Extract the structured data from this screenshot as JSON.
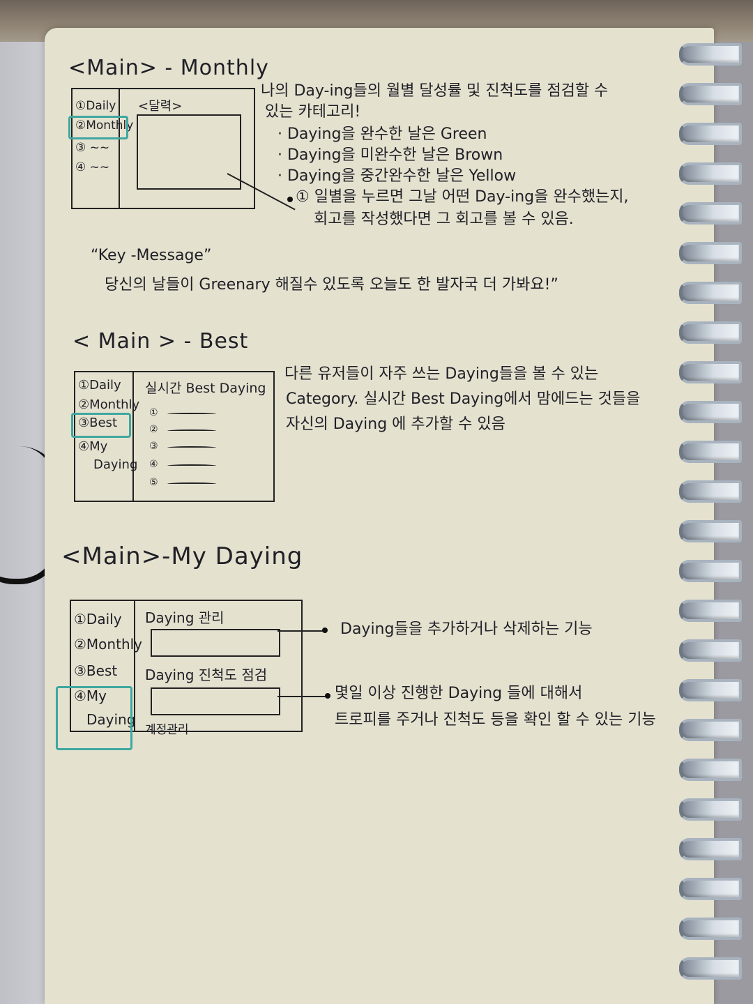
{
  "monthly": {
    "title": "<Main> - Monthly",
    "menu": [
      "①Daily",
      "②Monthly",
      "③ ~~",
      "④ ~~"
    ],
    "calendar_label": "<달력>",
    "desc": [
      "나의 Day-ing들의 월별 달성률 및 진척도를 점검할 수",
      "있는 카테고리!",
      "· Daying을 완수한 날은 Green",
      "· Daying을 미완수한 날은 Brown",
      "· Daying을 중간완수한 날은 Yellow"
    ],
    "note": [
      "① 일별을 누르면 그날 어떤 Day-ing을 완수했는지,",
      "회고를 작성했다면 그 회고를 볼 수 있음."
    ],
    "key_label": "“Key -Message”",
    "key_message": "당신의 날들이 Greenary 해질수 있도록 오늘도 한 발자국 더 가봐요!”"
  },
  "best": {
    "title": "< Main > - Best",
    "menu": [
      "①Daily",
      "②Monthly",
      "③Best",
      "④My",
      "Daying"
    ],
    "list_title": "실시간 Best Daying",
    "list_items": [
      "①",
      "②",
      "③",
      "④",
      "⑤"
    ],
    "desc": [
      "다른 유저들이 자주 쓰는 Daying들을 볼 수 있는",
      "Category. 실시간 Best Daying에서 맘에드는 것들을",
      "자신의 Daying 에 추가할 수 있음"
    ]
  },
  "mydaying": {
    "title": "<Main>-My Daying",
    "menu": [
      "①Daily",
      "②Monthly",
      "③Best",
      "④My",
      "Daying"
    ],
    "manage_label": "Daying 관리",
    "progress_label": "Daying 진척도 점검",
    "account_label": "계정관리",
    "desc_manage": "Daying들을 추가하거나 삭제하는 기능",
    "desc_progress": [
      "몇일 이상 진행한 Daying 들에 대해서",
      "트로피를 주거나 진척도 등을 확인 할 수 있는 기능"
    ]
  },
  "colors": {
    "accent": "#3fa7a0",
    "paper": "#e4e1cf",
    "ink": "#1f1f26"
  }
}
